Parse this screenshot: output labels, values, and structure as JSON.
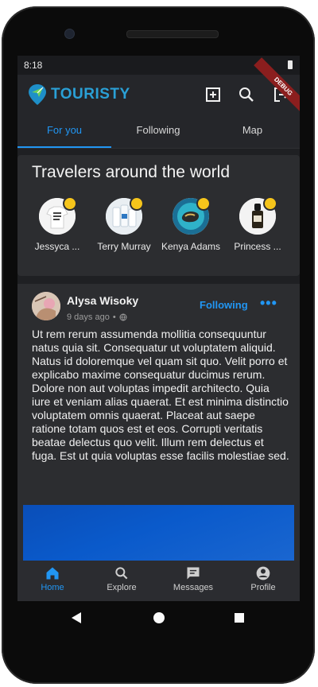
{
  "status_bar": {
    "time": "8:18"
  },
  "app_bar": {
    "logo_text": "TOURISTY",
    "debug_label": "DEBUG",
    "icons": [
      "add-box-icon",
      "search-icon",
      "logout-icon"
    ]
  },
  "tabs": [
    {
      "label": "For you",
      "active": true
    },
    {
      "label": "Following",
      "active": false
    },
    {
      "label": "Map",
      "active": false
    }
  ],
  "travelers": {
    "title": "Travelers around the world",
    "people": [
      {
        "name": "Jessyca ...",
        "thumb": "tshirt-thumbnail"
      },
      {
        "name": "Terry Murray",
        "thumb": "bottles-thumbnail"
      },
      {
        "name": "Kenya Adams",
        "thumb": "soap-thumbnail"
      },
      {
        "name": "Princess ...",
        "thumb": "dropper-bottle-thumbnail"
      }
    ]
  },
  "post": {
    "author": "Alysa Wisoky",
    "time": "9 days ago",
    "separator": "•",
    "visibility_icon": "globe-icon",
    "follow_label": "Following",
    "more_label": "•••",
    "body": "Ut rem rerum assumenda mollitia consequuntur natus quia sit. Consequatur ut voluptatem aliquid. Natus id doloremque vel quam sit quo. Velit porro et explicabo maxime consequatur ducimus rerum. Dolore non aut voluptas impedit architecto. Quia iure et veniam alias quaerat. Et est minima distinctio voluptatem omnis quaerat. Placeat aut saepe ratione totam quos est et eos. Corrupti veritatis beatae delectus quo velit. Illum rem delectus et fuga. Est ut quia voluptas esse facilis molestiae sed."
  },
  "bottom_nav": [
    {
      "label": "Home",
      "icon": "home-icon",
      "active": true
    },
    {
      "label": "Explore",
      "icon": "search-icon",
      "active": false
    },
    {
      "label": "Messages",
      "icon": "chat-icon",
      "active": false
    },
    {
      "label": "Profile",
      "icon": "account-icon",
      "active": false
    }
  ],
  "colors": {
    "accent": "#2196f3",
    "background": "#1f2023",
    "card": "#2c2d30",
    "appbar": "#25262a",
    "logo": "#2aa0d6"
  }
}
